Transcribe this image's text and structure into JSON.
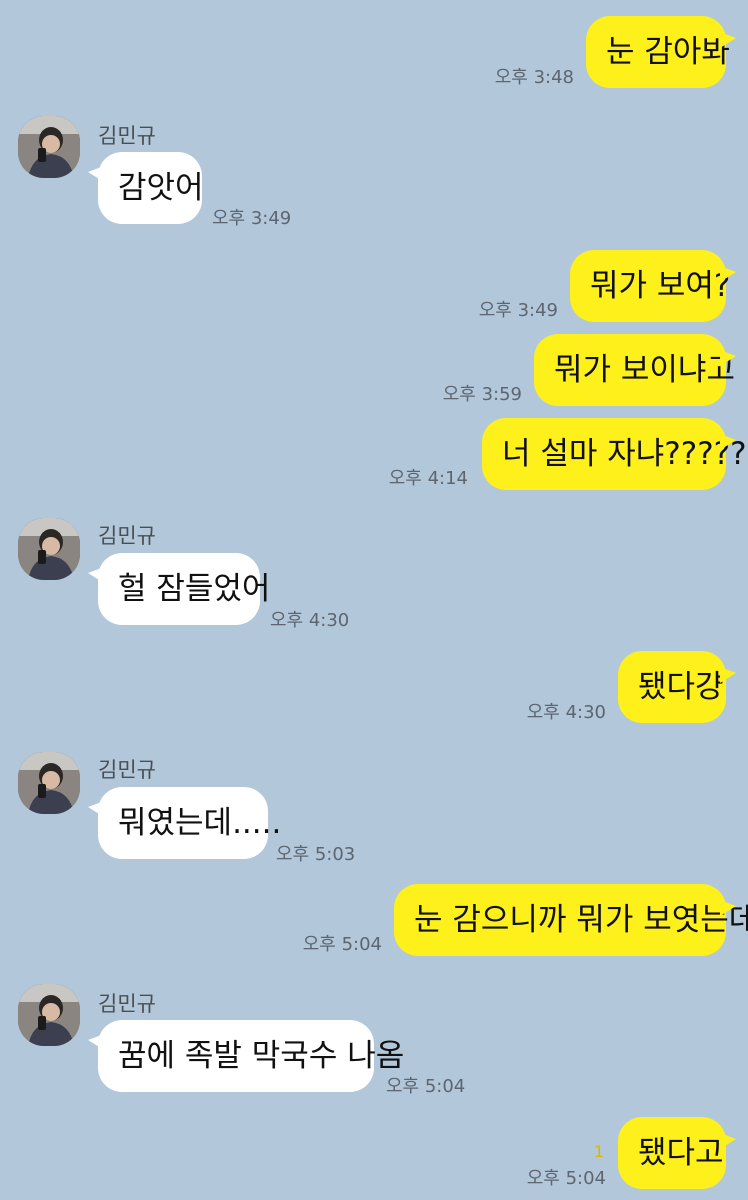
{
  "contact": {
    "name": "김민규"
  },
  "messages": [
    {
      "from": "me",
      "text": "눈 감아봐",
      "time": "오후 3:48"
    },
    {
      "from": "other",
      "text": "감앗어",
      "time": "오후 3:49"
    },
    {
      "from": "me",
      "text": "뭐가 보여?",
      "time": "오후 3:49"
    },
    {
      "from": "me",
      "text": "뭐가 보이냐고",
      "time": "오후 3:59"
    },
    {
      "from": "me",
      "text": "너 설마 자냐?????",
      "time": "오후 4:14"
    },
    {
      "from": "other",
      "text": "헐 잠들었어",
      "time": "오후 4:30"
    },
    {
      "from": "me",
      "text": "됐다걍",
      "time": "오후 4:30"
    },
    {
      "from": "other",
      "text": "뭐였는데.....",
      "time": "오후 5:03"
    },
    {
      "from": "me",
      "text": "눈 감으니까 뭐가 보엿는데",
      "time": "오후 5:04"
    },
    {
      "from": "other",
      "text": "꿈에 족발 막국수 나옴",
      "time": "오후 5:04"
    },
    {
      "from": "me",
      "text": "됐다고",
      "time": "오후 5:04",
      "unread": "1"
    }
  ],
  "colors": {
    "background": "#b2c7da",
    "my_bubble": "#fef01b",
    "other_bubble": "#ffffff"
  }
}
